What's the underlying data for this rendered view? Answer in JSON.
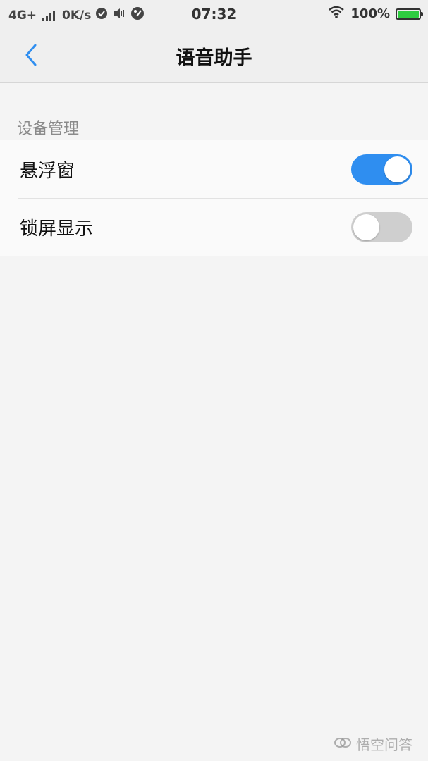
{
  "status_bar": {
    "network": "4G+",
    "speed": "0K/s",
    "time": "07:32",
    "battery": "100%",
    "battery_level": 1.0,
    "icons": [
      "signal-icon",
      "check-circle-icon",
      "vibrate-icon",
      "paint-icon",
      "wifi-icon",
      "battery-icon"
    ]
  },
  "nav": {
    "title": "语音助手",
    "back_icon": "chevron-left-icon"
  },
  "section": {
    "header": "设备管理",
    "items": [
      {
        "label": "悬浮窗",
        "toggle": true
      },
      {
        "label": "锁屏显示",
        "toggle": false
      }
    ]
  },
  "colors": {
    "toggle_on": "#2f8ef0",
    "toggle_off": "#cfcfcf",
    "accent": "#2f8ef0",
    "battery": "#2ecc40"
  },
  "watermark": {
    "text": "悟空问答"
  }
}
